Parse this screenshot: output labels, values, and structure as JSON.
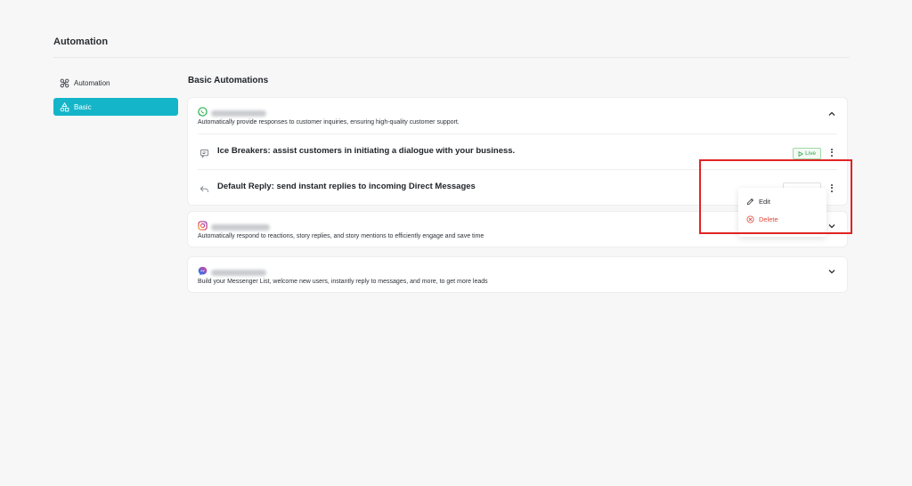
{
  "page": {
    "title": "Automation"
  },
  "sidebar": {
    "items": [
      {
        "label": "Automation",
        "icon": "automation-icon"
      },
      {
        "label": "Basic",
        "icon": "shapes-icon",
        "active": true
      }
    ]
  },
  "main": {
    "section_title": "Basic Automations",
    "cards": [
      {
        "icon": "whatsapp-icon",
        "description": "Automatically provide responses to customer inquiries, ensuring high-quality customer support.",
        "expanded": true,
        "rows": [
          {
            "icon": "chat-icon",
            "text": "Ice Breakers: assist customers in initiating a dialogue with your business.",
            "status": "Live"
          },
          {
            "icon": "reply-icon",
            "text": "Default Reply: send instant replies to incoming Direct Messages",
            "status": ""
          }
        ]
      },
      {
        "icon": "instagram-icon",
        "description": "Automatically respond to reactions, story replies, and story mentions to efficiently engage and save time",
        "expanded": false
      },
      {
        "icon": "messenger-icon",
        "description": "Build your Messenger List, welcome new users, instantly reply to messages, and more, to get more leads",
        "expanded": false
      }
    ]
  },
  "context_menu": {
    "items": [
      {
        "label": "Edit",
        "icon": "pencil-icon"
      },
      {
        "label": "Delete",
        "icon": "delete-circle-icon"
      }
    ]
  },
  "colors": {
    "accent": "#14b5c9",
    "live_green": "#2fa64a",
    "danger": "#e0473a",
    "highlight_box": "#e02424"
  }
}
